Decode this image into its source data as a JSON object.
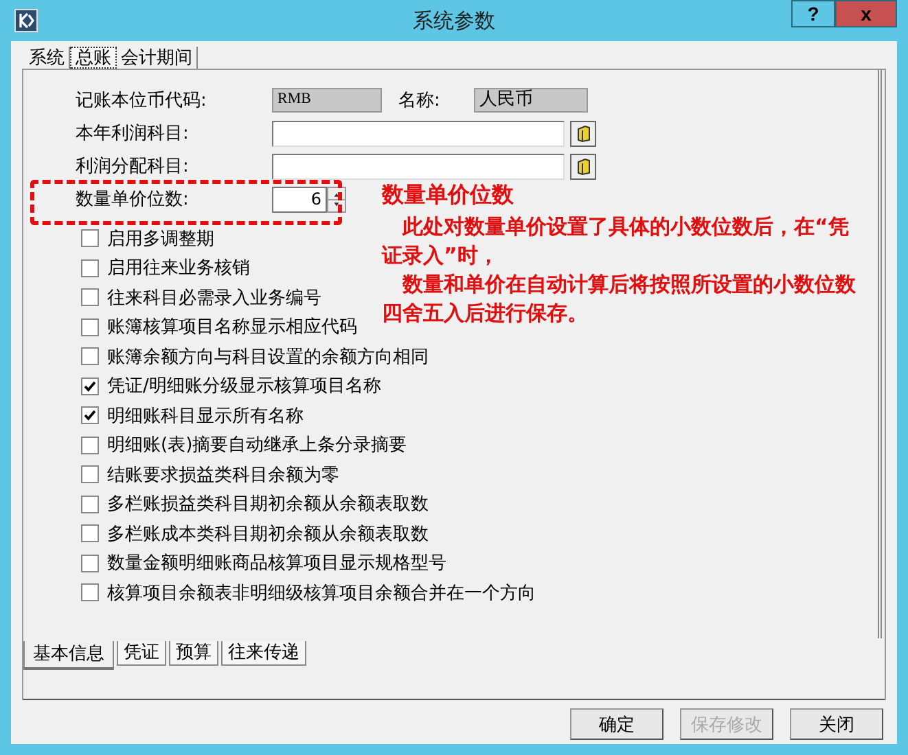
{
  "window": {
    "title": "系统参数",
    "help_button": "?",
    "close_button": "x"
  },
  "top_tabs": [
    {
      "label": "系统",
      "selected": false
    },
    {
      "label": "总账",
      "selected": true
    },
    {
      "label": "会计期间",
      "selected": false
    }
  ],
  "fields": [
    {
      "kind": "pair",
      "label": "记账本位币代码:",
      "value": "RMB",
      "label2": "名称:",
      "value2": "人民币"
    },
    {
      "kind": "browse",
      "label": "本年利润科目:"
    },
    {
      "kind": "browse",
      "label": "利润分配科目:"
    },
    {
      "kind": "spin",
      "label": "数量单价位数:",
      "value": "6",
      "highlighted": true
    }
  ],
  "annotation": {
    "title": "数量单价位数",
    "paragraphs": [
      "此处对数量单价设置了具体的小数位数后，在“凭证录入”时，",
      "数量和单价在自动计算后将按照所设置的小数位数四舍五入后进行保存。"
    ]
  },
  "options": [
    {
      "label": "启用多调整期",
      "checked": false
    },
    {
      "label": "启用往来业务核销",
      "checked": false
    },
    {
      "label": "往来科目必需录入业务编号",
      "checked": false
    },
    {
      "label": "账簿核算项目名称显示相应代码",
      "checked": false
    },
    {
      "label": "账簿余额方向与科目设置的余额方向相同",
      "checked": false
    },
    {
      "label": "凭证/明细账分级显示核算项目名称",
      "checked": true
    },
    {
      "label": "明细账科目显示所有名称",
      "checked": true
    },
    {
      "label": "明细账(表)摘要自动继承上条分录摘要",
      "checked": false
    },
    {
      "label": "结账要求损益类科目余额为零",
      "checked": false
    },
    {
      "label": "多栏账损益类科目期初余额从余额表取数",
      "checked": false
    },
    {
      "label": "多栏账成本类科目期初余额从余额表取数",
      "checked": false
    },
    {
      "label": "数量金额明细账商品核算项目显示规格型号",
      "checked": false
    },
    {
      "label": "核算项目余额表非明细级核算项目余额合并在一个方向",
      "checked": false
    }
  ],
  "bottom_tabs": [
    {
      "label": "基本信息",
      "selected": true
    },
    {
      "label": "凭证",
      "selected": false
    },
    {
      "label": "预算",
      "selected": false
    },
    {
      "label": "往来传递",
      "selected": false
    }
  ],
  "buttons": [
    {
      "label": "确定",
      "disabled": false
    },
    {
      "label": "保存修改",
      "disabled": true
    },
    {
      "label": "关闭",
      "disabled": false
    }
  ]
}
